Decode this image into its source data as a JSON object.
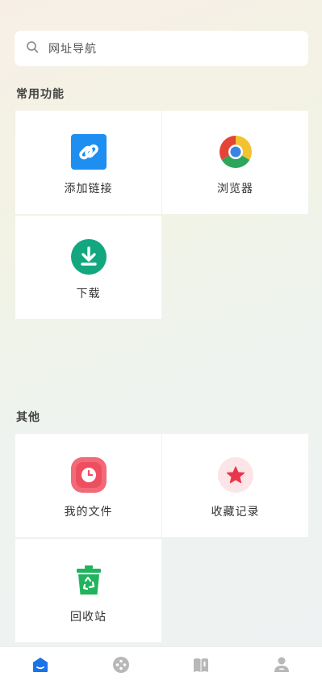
{
  "search": {
    "placeholder": "网址导航"
  },
  "sections": {
    "common": {
      "title": "常用功能",
      "items": [
        {
          "label": "添加链接",
          "icon": "link-icon"
        },
        {
          "label": "浏览器",
          "icon": "chrome-browser-icon"
        },
        {
          "label": "下载",
          "icon": "download-icon"
        }
      ]
    },
    "other": {
      "title": "其他",
      "items": [
        {
          "label": "我的文件",
          "icon": "clock-file-icon"
        },
        {
          "label": "收藏记录",
          "icon": "star-icon"
        },
        {
          "label": "回收站",
          "icon": "recycle-bin-icon"
        }
      ]
    }
  },
  "tabbar": {
    "tabs": [
      {
        "icon": "home-icon",
        "active": true
      },
      {
        "icon": "film-reel-icon",
        "active": false
      },
      {
        "icon": "book-icon",
        "active": false
      },
      {
        "icon": "user-icon",
        "active": false
      }
    ]
  },
  "colors": {
    "accent": "#1a73e8",
    "inactive": "#b8b8b8"
  }
}
